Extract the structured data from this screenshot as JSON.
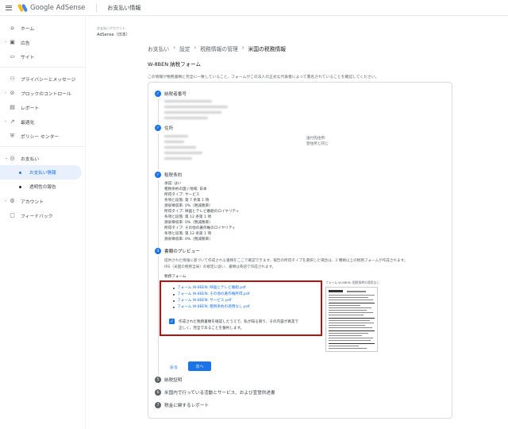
{
  "header": {
    "logo_text": "Google AdSense",
    "page_title": "お支払い情報"
  },
  "sidebar": {
    "items": [
      {
        "label": "ホーム"
      },
      {
        "label": "広告"
      },
      {
        "label": "サイト"
      },
      {
        "label": "プライバシーとメッセージ"
      },
      {
        "label": "ブロックのコントロール"
      },
      {
        "label": "レポート"
      },
      {
        "label": "最適化"
      },
      {
        "label": "ポリシー センター"
      },
      {
        "label": "お支払い"
      },
      {
        "label": "アカウント"
      },
      {
        "label": "フィードバック"
      }
    ],
    "payments_sub": [
      {
        "label": "お支払い情報"
      },
      {
        "label": "透明性の報告"
      }
    ]
  },
  "account": {
    "caption": "お支払いアカウント",
    "name": "AdSense（日本）"
  },
  "breadcrumb": [
    "お支払い",
    "›",
    "設定",
    "›",
    "税務情報の管理",
    "›",
    "米国の税務情報"
  ],
  "form": {
    "title": "W-8BEN 納税フォーム",
    "description": "この情報が税務書類と完全に一致していること、フォームがこの法人の正式な代表者によって署名されていることを確認してください。"
  },
  "steps": {
    "taxpayer_id": "納税者番号",
    "address": "住所",
    "address_right_1": "送付先住所:",
    "address_right_2": "登住所と同じ",
    "treaty": "租税条約",
    "treaty_lines": [
      "承認: はい",
      "租税条約の国 / 地域: 日本",
      "所得タイプ: サービス",
      "条項と段落: 第 7 条第 1 項",
      "源泉徴収率: 0%（税減税率）",
      "所得タイプ: 映画とテレビ番組のロイヤリティ",
      "条項と段落: 第 12 条第 1 項",
      "源泉徴収率: 0%（税減税率）",
      "所得タイプ: その他の著作権のロイヤリティ",
      "条項と段落: 第 12 条第 1 項",
      "源泉徴収率: 0%（税減税率）"
    ],
    "preview": "書類のプレビュー",
    "preview_desc_1": "提供された情報に基づいて作成される書類をここで確認できます。報告の所得タイプを選択した場合は、2 種類以上の税務フォームが作成されます。",
    "preview_desc_2": "IRS（米国の税務当局）の規定に従い、書類は英語で作成されます。",
    "forms_label": "税務フォーム",
    "form_links": [
      "フォーム W-8BEN: 映画とテレビ番組.pdf",
      "フォーム W-8BEN: その他の著作権所得.pdf",
      "フォーム W-8BEN: サービス.pdf",
      "フォーム W-8BEN: 租税条約の適用なし.pdf"
    ],
    "confirm_line_1": "作成された税務書類を確認したうえで、私が知る限り、その内容が真実で",
    "confirm_line_2": "正しく、完全であることを誓約します。",
    "preview_caption": "フォーム W-8BEN: 租税条約の適用なし",
    "back_button": "戻る",
    "next_button": "次へ",
    "step5_num": "5",
    "step5": "納税証明",
    "step6_num": "6",
    "step6": "米国内で行っている活動とサービス、および宣誓供述書",
    "step7_num": "7",
    "step7": "税金に関するレポート",
    "step4_num": "4"
  }
}
